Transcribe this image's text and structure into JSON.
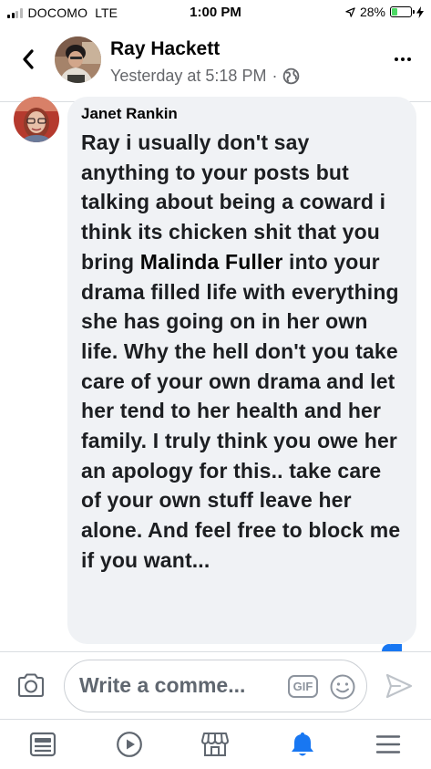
{
  "status_bar": {
    "carrier": "DOCOMO",
    "network": "LTE",
    "time": "1:00 PM",
    "battery_percent": "28%",
    "battery_level": 0.28,
    "icons": [
      "signal-icon",
      "location-arrow-icon",
      "battery-icon",
      "charging-bolt-icon"
    ]
  },
  "header": {
    "name": "Ray Hackett",
    "timestamp": "Yesterday at 5:18 PM",
    "separator": "·",
    "icons": [
      "back-chevron-icon",
      "globe-icon",
      "more-options-icon"
    ]
  },
  "comment": {
    "author": "Janet Rankin",
    "text_before": "Ray i usually don't say anything to your posts but talking about being a coward i think its chicken shit that you bring ",
    "mention": "Malinda Fuller",
    "text_after": " into your drama filled life with everything she has going on in her own life.  Why the hell don't you take care of your own drama and let her tend to her health and her family.  I truly think you owe her an apology for this.. take care of your own stuff leave her alone.  And feel free to block me if you want..."
  },
  "composer": {
    "placeholder": "Write a comme...",
    "gif_label": "GIF",
    "icons": [
      "camera-icon",
      "emoji-icon",
      "send-icon"
    ]
  },
  "nav": {
    "items": [
      "news-feed-icon",
      "watch-icon",
      "marketplace-icon",
      "notifications-icon",
      "menu-icon"
    ],
    "active_index": 3
  },
  "colors": {
    "accent": "#1877f2",
    "bubble": "#f0f2f5",
    "secondary_text": "#65676b",
    "icon_gray": "#606770",
    "battery_green": "#4cd964"
  }
}
